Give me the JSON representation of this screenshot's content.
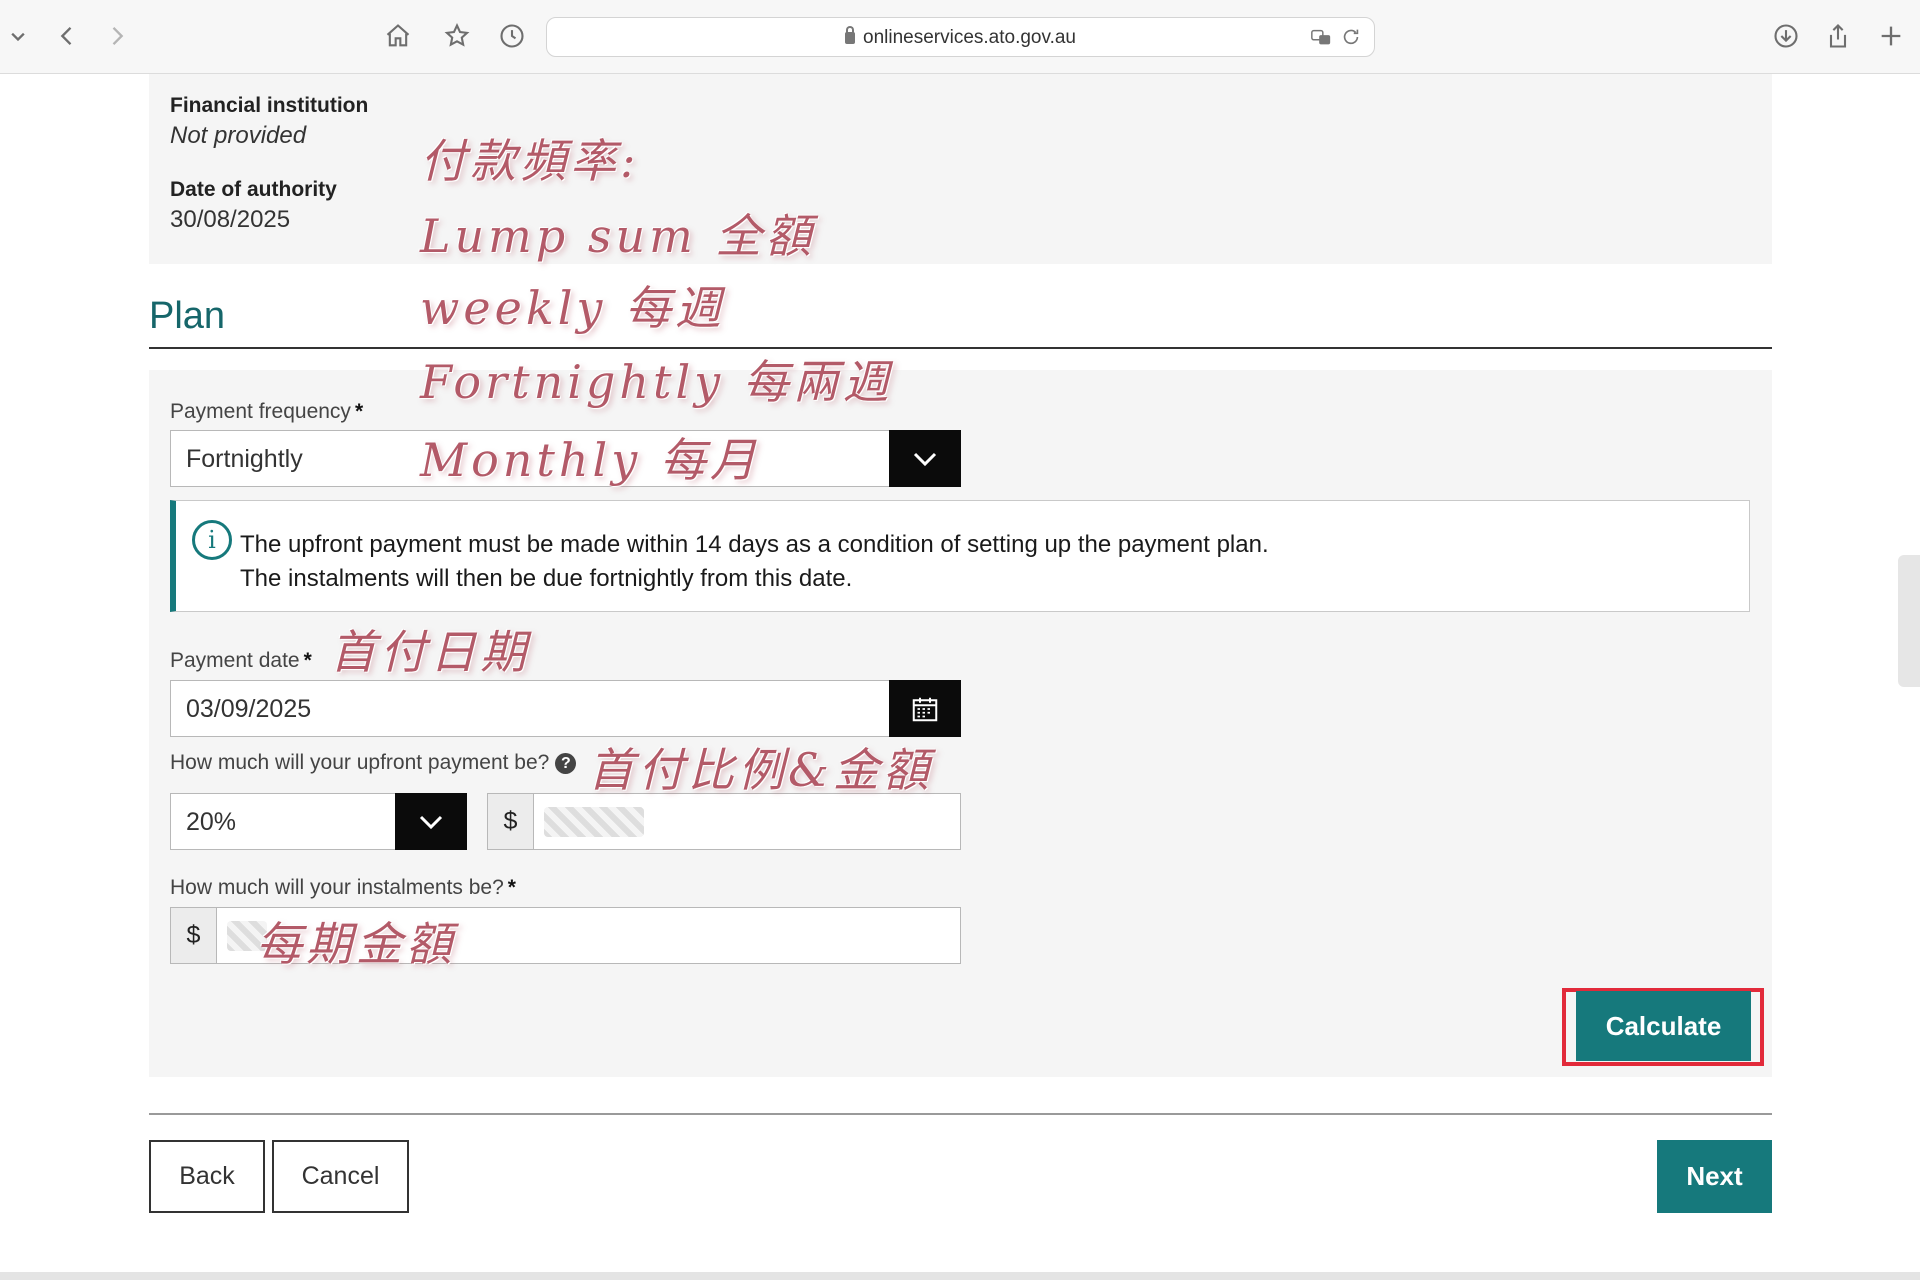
{
  "browser": {
    "url": "onlineservices.ato.gov.au"
  },
  "authority": {
    "institution_label": "Financial institution",
    "institution_value": "Not provided",
    "date_label": "Date of authority",
    "date_value": "30/08/2025"
  },
  "plan": {
    "title": "Plan",
    "frequency_label": "Payment frequency",
    "required_mark": "*",
    "frequency_value": "Fortnightly",
    "info_line1": "The upfront payment must be made within 14 days as a condition of setting up the payment plan.",
    "info_line2": "The instalments will then be due fortnightly from this date.",
    "payment_date_label": "Payment date",
    "payment_date_value": "03/09/2025",
    "upfront_label": "How much will your upfront payment be?",
    "help_symbol": "?",
    "upfront_percent": "20%",
    "currency_symbol": "$",
    "instalment_label": "How much will your instalments be?",
    "calculate_label": "Calculate"
  },
  "actions": {
    "back_label": "Back",
    "cancel_label": "Cancel",
    "next_label": "Next"
  },
  "annotations": {
    "frequency_heading": "付款頻率:",
    "lump_sum": "Lump sum 全額",
    "weekly": "weekly 每週",
    "fortnightly": "Fortnightly 每兩週",
    "monthly": "Monthly 每月",
    "first_payment_date": "首付日期",
    "upfront_ratio": "首付比例&金額",
    "instalment_amount": "每期金額"
  },
  "colors": {
    "accent": "#16797c",
    "highlight": "#e22a3a",
    "handwriting": "#b35a68"
  }
}
